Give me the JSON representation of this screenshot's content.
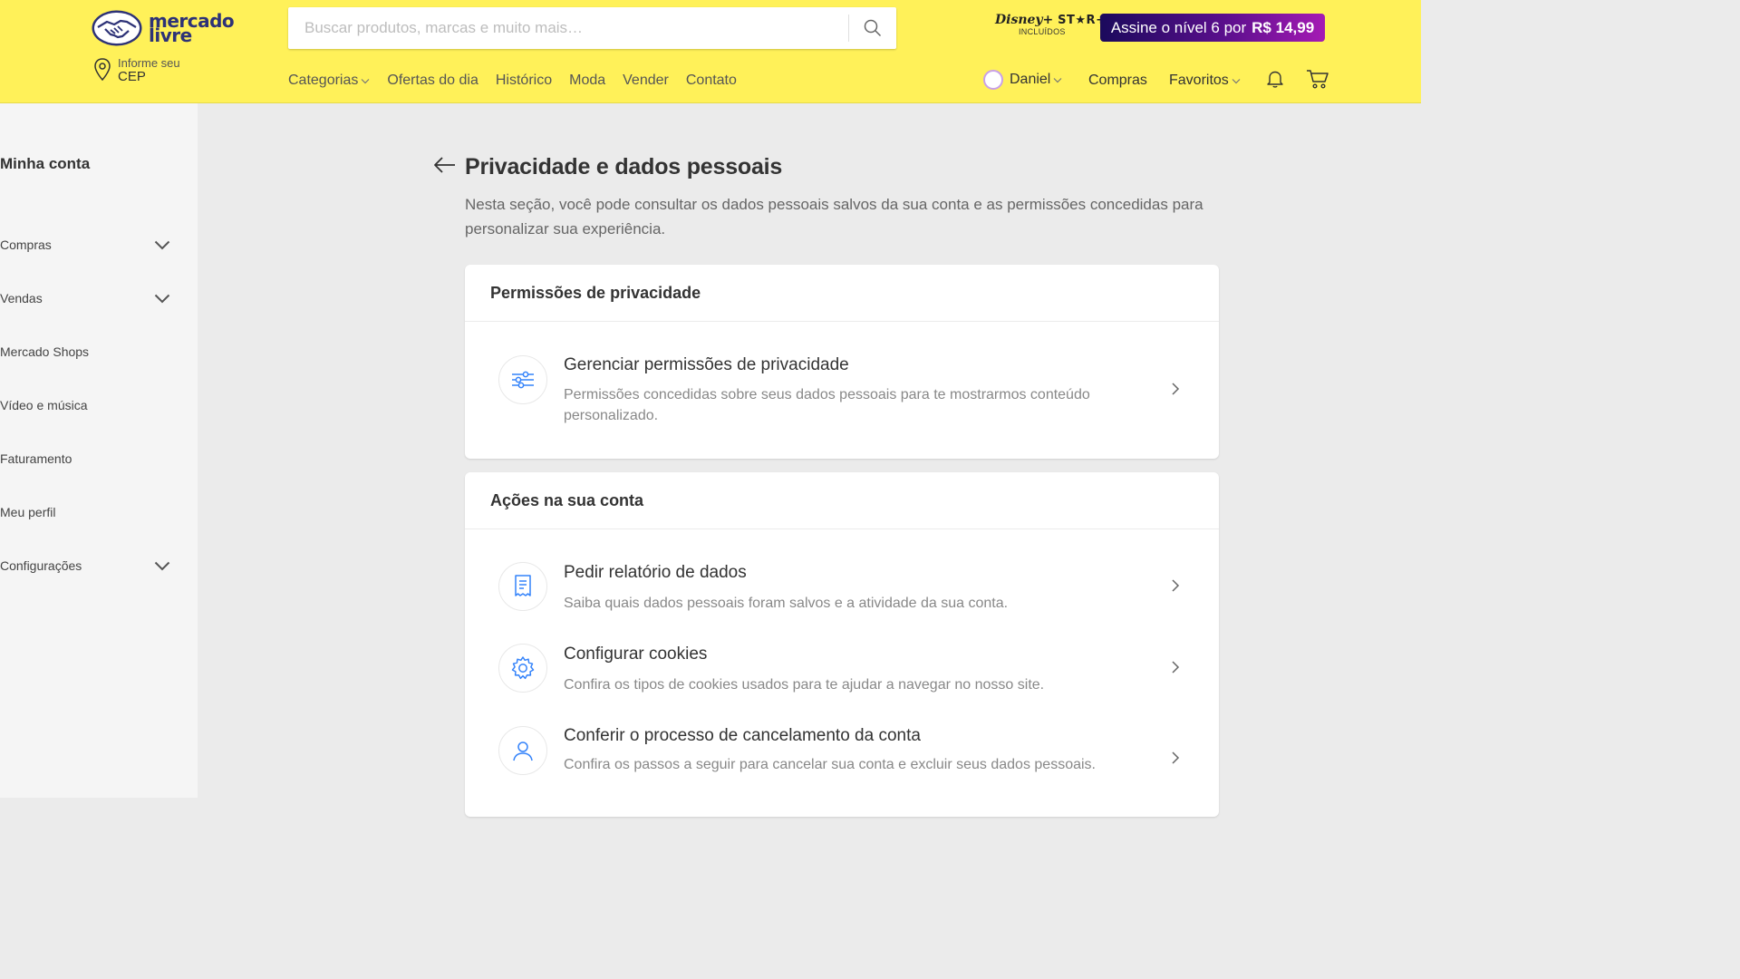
{
  "header": {
    "logo_line1": "mercado",
    "logo_line2": "livre",
    "cep_small": "Informe seu",
    "cep_big": "CEP",
    "search_placeholder": "Buscar produtos, marcas e muito mais…",
    "disney_brand": "Disney+",
    "star_brand": "ST★R+",
    "disney_sub": "INCLUÍDOS",
    "promo_text": "Assine o nível 6 por",
    "promo_price": "R$ 14,99",
    "nav": [
      "Categorias",
      "Ofertas do dia",
      "Histórico",
      "Moda",
      "Vender",
      "Contato"
    ],
    "user_name": "Daniel",
    "compras": "Compras",
    "favoritos": "Favoritos"
  },
  "sidebar": {
    "title": "Minha conta",
    "items": [
      {
        "label": "Compras",
        "expandable": true
      },
      {
        "label": "Vendas",
        "expandable": true
      },
      {
        "label": "Mercado Shops",
        "expandable": false
      },
      {
        "label": "Vídeo e música",
        "expandable": false
      },
      {
        "label": "Faturamento",
        "expandable": false
      },
      {
        "label": "Meu perfil",
        "expandable": false
      },
      {
        "label": "Configurações",
        "expandable": true
      }
    ]
  },
  "main": {
    "title": "Privacidade e dados pessoais",
    "description": "Nesta seção, você pode consultar os dados pessoais salvos da sua conta e as permissões concedidas para personalizar sua experiência.",
    "cards": [
      {
        "title": "Permissões de privacidade",
        "rows": [
          {
            "icon": "sliders-icon",
            "title": "Gerenciar permissões de privacidade",
            "desc": "Permissões concedidas sobre seus dados pessoais para te mostrarmos conteúdo personalizado."
          }
        ]
      },
      {
        "title": "Ações na sua conta",
        "rows": [
          {
            "icon": "document-icon",
            "title": "Pedir relatório de dados",
            "desc": "Saiba quais dados pessoais foram salvos e a atividade da sua conta."
          },
          {
            "icon": "gear-icon",
            "title": "Configurar cookies",
            "desc": "Confira os tipos de cookies usados para te ajudar a navegar no nosso site."
          },
          {
            "icon": "user-icon",
            "title": "Conferir o processo de cancelamento da conta",
            "desc": "Confira os passos a seguir para cancelar sua conta e excluir seus dados pessoais."
          }
        ]
      }
    ]
  },
  "colors": {
    "header_bg": "#fff159",
    "accent_blue": "#3483fa",
    "logo_navy": "#2d3277",
    "promo_start": "#1b0a5c",
    "promo_end": "#a51ab4"
  }
}
